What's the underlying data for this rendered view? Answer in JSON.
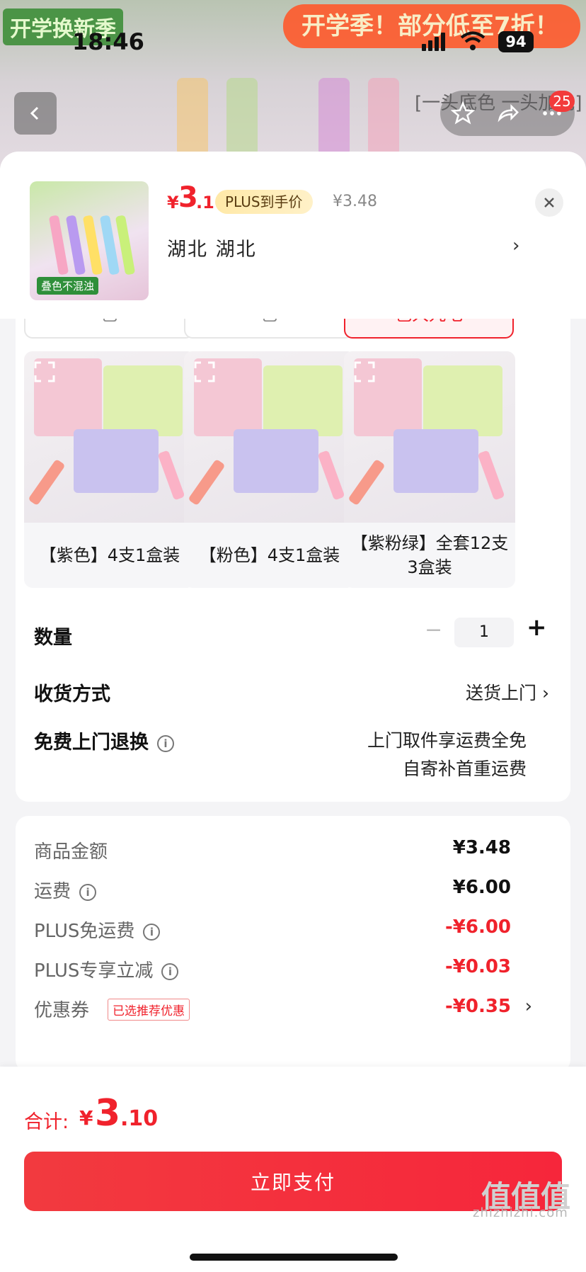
{
  "status_bar": {
    "time": "18:46",
    "battery": "94"
  },
  "backdrop": {
    "left_banner": "开学换新季",
    "promo_banner": "开学季！部分低至7折！",
    "note": "[一头底色 一头加色]",
    "message_count": "25"
  },
  "product": {
    "thumb_tag": "叠色不混浊",
    "price_currency": "¥",
    "price_int": "3",
    "price_dec": ".1",
    "plus_tag": "PLUS到手价",
    "original_price": "¥3.48",
    "region": "湖北  湖北"
  },
  "options": {
    "stubs": [
      "色",
      "色",
      "色大九毛"
    ],
    "variants": [
      {
        "label": "【紫色】4支1盒装"
      },
      {
        "label": "【粉色】4支1盒装"
      },
      {
        "label": "【紫粉绿】全套12支3盒装"
      }
    ]
  },
  "quantity": {
    "label": "数量",
    "value": "1",
    "minus": "−",
    "plus": "+"
  },
  "shipping": {
    "label": "收货方式",
    "value": "送货上门 ›"
  },
  "returns": {
    "label": "免费上门退换",
    "line1": "上门取件享运费全免",
    "line2": "自寄补首重运费"
  },
  "summary": {
    "rows": [
      {
        "label": "商品金额",
        "value": "¥3.48"
      },
      {
        "label": "运费",
        "value": "¥6.00"
      },
      {
        "label": "PLUS免运费",
        "value": "-¥6.00"
      },
      {
        "label": "PLUS专享立减",
        "value": "-¥0.03"
      },
      {
        "label": "优惠券",
        "value": "-¥0.35",
        "tag": "已选推荐优惠"
      }
    ]
  },
  "footer": {
    "total_label": "合计:",
    "total_currency": "¥",
    "total_int": "3",
    "total_dec": ".10",
    "pay_button": "立即支付"
  },
  "watermark": {
    "logo": "值值值",
    "text": "zhizhizhi.com"
  },
  "colors": {
    "accent": "#f0222c",
    "plus_gold": "#ffe9a8"
  }
}
